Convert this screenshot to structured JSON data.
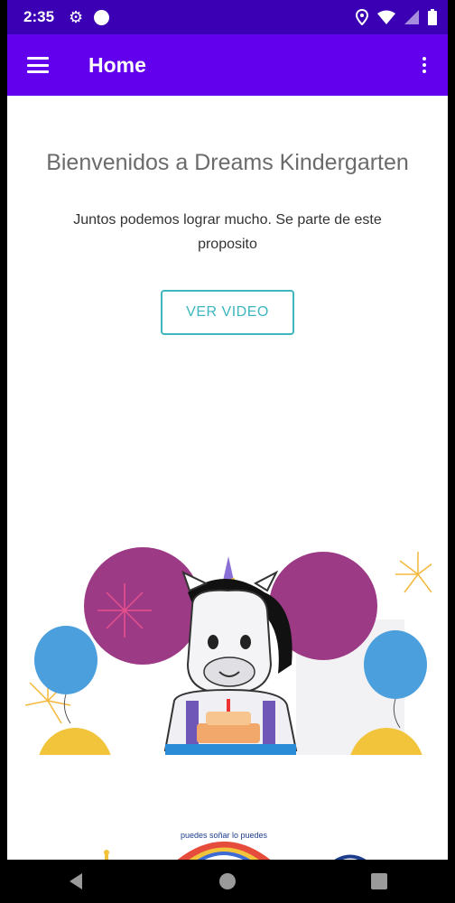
{
  "status_bar": {
    "time": "2:35"
  },
  "app_bar": {
    "title": "Home"
  },
  "main": {
    "welcome_title": "Bienvenidos a Dreams Kindergarten",
    "subtitle": "Juntos podemos lograr mucho. Se parte de este proposito",
    "video_button_label": "VER VIDEO"
  },
  "logo": {
    "arc_text": "puedes soñar lo puedes"
  },
  "colors": {
    "status_bar": "#3b00b3",
    "app_bar": "#6200ee",
    "accent": "#3db6c0"
  }
}
